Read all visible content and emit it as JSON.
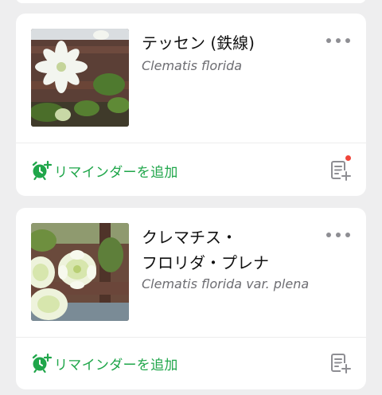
{
  "colors": {
    "accent_green": "#1fa64a",
    "background": "#eeeeef",
    "badge_red": "#f0453a",
    "secondary_text": "#6d6d72"
  },
  "plants": [
    {
      "name": "テッセン (鉄線)",
      "scientific_name": "Clematis florida",
      "reminder_label": "リマインダーを追加",
      "has_note_badge": true,
      "photo_icon": "clematis-photo"
    },
    {
      "name": "クレマチス・\nフロリダ・プレナ",
      "scientific_name": "Clematis florida var. plena",
      "reminder_label": "リマインダーを追加",
      "has_note_badge": false,
      "photo_icon": "clematis-plena-photo"
    }
  ],
  "icons": {
    "more": "more-horizontal-icon",
    "reminder": "alarm-plus-icon",
    "note": "note-add-icon"
  }
}
